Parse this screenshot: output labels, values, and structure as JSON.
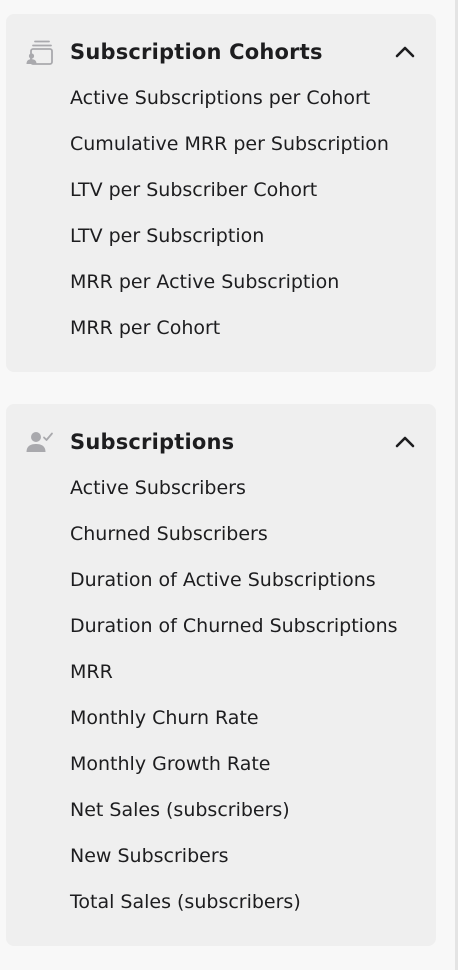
{
  "sections": [
    {
      "title": "Subscription Cohorts",
      "icon": "stacked-cards-user-icon",
      "expanded": true,
      "items": [
        "Active Subscriptions per Cohort",
        "Cumulative MRR per Subscription",
        "LTV per Subscriber Cohort",
        "LTV per Subscription",
        "MRR per Active Subscription",
        "MRR per Cohort"
      ]
    },
    {
      "title": "Subscriptions",
      "icon": "user-check-icon",
      "expanded": true,
      "items": [
        "Active Subscribers",
        "Churned Subscribers",
        "Duration of Active Subscriptions",
        "Duration of Churned Subscriptions",
        "MRR",
        "Monthly Churn Rate",
        "Monthly Growth Rate",
        "Net Sales (subscribers)",
        "New Subscribers",
        "Total Sales (subscribers)"
      ]
    }
  ],
  "colors": {
    "page_background": "#f8f8f8",
    "card_background": "#efefef",
    "text": "#1d1d1f",
    "icon_gray": "#a9a9ad"
  }
}
